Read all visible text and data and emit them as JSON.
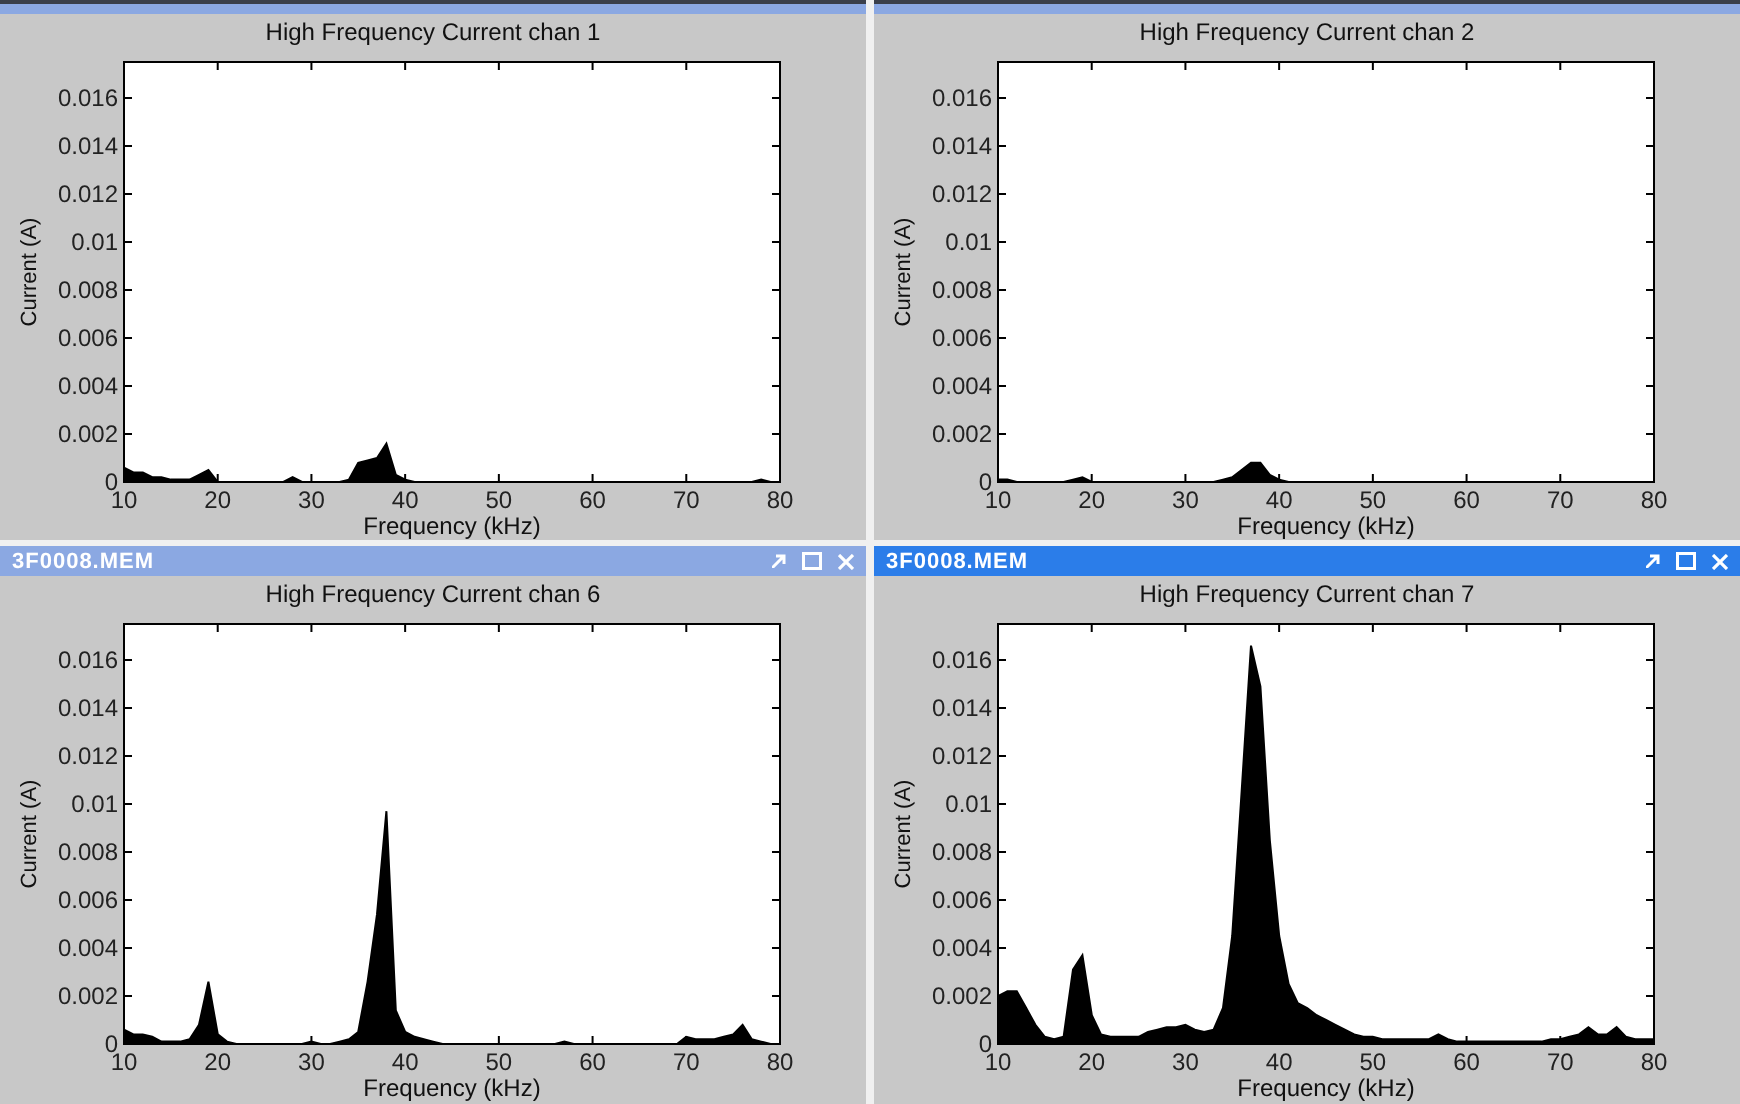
{
  "windows": [
    {
      "active": false,
      "chart_data": {
        "type": "area",
        "title": "High Frequency Current chan 1",
        "xlabel": "Frequency (kHz)",
        "ylabel": "Current (A)",
        "xlim": [
          10,
          80
        ],
        "ylim": [
          0,
          0.0175
        ],
        "xticks": [
          10,
          20,
          30,
          40,
          50,
          60,
          70,
          80
        ],
        "yticks": [
          {
            "value": 0,
            "label": "0"
          },
          {
            "value": 0.002,
            "label": "0.002"
          },
          {
            "value": 0.004,
            "label": "0.004"
          },
          {
            "value": 0.006,
            "label": "0.006"
          },
          {
            "value": 0.008,
            "label": "0.008"
          },
          {
            "value": 0.01,
            "label": "0.01"
          },
          {
            "value": 0.012,
            "label": "0.012"
          },
          {
            "value": 0.014,
            "label": "0.014"
          },
          {
            "value": 0.016,
            "label": "0.016"
          }
        ],
        "x": [
          10,
          11,
          12,
          13,
          14,
          15,
          16,
          17,
          18,
          19,
          20,
          21,
          22,
          23,
          24,
          25,
          26,
          27,
          28,
          29,
          30,
          31,
          32,
          33,
          34,
          35,
          36,
          37,
          38,
          39,
          40,
          41,
          42,
          43,
          44,
          45,
          46,
          47,
          48,
          49,
          50,
          51,
          52,
          53,
          54,
          55,
          56,
          57,
          58,
          59,
          60,
          61,
          62,
          63,
          64,
          65,
          66,
          67,
          68,
          69,
          70,
          71,
          72,
          73,
          74,
          75,
          76,
          77,
          78,
          79,
          80
        ],
        "series": [
          {
            "color": "#000000",
            "values": [
              0.0006,
              0.0004,
              0.0004,
              0.0002,
              0.0002,
              0.0001,
              0.0001,
              0.0001,
              0.0003,
              0.0005,
              0,
              0,
              0,
              0,
              0,
              0,
              0,
              0,
              0.0002,
              0,
              0,
              0,
              0,
              0,
              0.0001,
              0.0008,
              0.0009,
              0.001,
              0.0016,
              0.0003,
              0.0001,
              0,
              0,
              0,
              0,
              0,
              0,
              0,
              0,
              0,
              0,
              0,
              0,
              0,
              0,
              0,
              0,
              0,
              0,
              0,
              0,
              0,
              0,
              0,
              0,
              0,
              0,
              0,
              0,
              0,
              0,
              0,
              0,
              0,
              0,
              0,
              0,
              0,
              0.0001,
              0,
              0
            ]
          }
        ]
      }
    },
    {
      "active": false,
      "chart_data": {
        "type": "area",
        "title": "High Frequency Current chan 2",
        "xlabel": "Frequency (kHz)",
        "ylabel": "Current (A)",
        "xlim": [
          10,
          80
        ],
        "ylim": [
          0,
          0.0175
        ],
        "xticks": [
          10,
          20,
          30,
          40,
          50,
          60,
          70,
          80
        ],
        "yticks": [
          {
            "value": 0,
            "label": "0"
          },
          {
            "value": 0.002,
            "label": "0.002"
          },
          {
            "value": 0.004,
            "label": "0.004"
          },
          {
            "value": 0.006,
            "label": "0.006"
          },
          {
            "value": 0.008,
            "label": "0.008"
          },
          {
            "value": 0.01,
            "label": "0.01"
          },
          {
            "value": 0.012,
            "label": "0.012"
          },
          {
            "value": 0.014,
            "label": "0.014"
          },
          {
            "value": 0.016,
            "label": "0.016"
          }
        ],
        "x": [
          10,
          11,
          12,
          13,
          14,
          15,
          16,
          17,
          18,
          19,
          20,
          21,
          22,
          23,
          24,
          25,
          26,
          27,
          28,
          29,
          30,
          31,
          32,
          33,
          34,
          35,
          36,
          37,
          38,
          39,
          40,
          41,
          42,
          43,
          44,
          45,
          46,
          47,
          48,
          49,
          50,
          51,
          52,
          53,
          54,
          55,
          56,
          57,
          58,
          59,
          60,
          61,
          62,
          63,
          64,
          65,
          66,
          67,
          68,
          69,
          70,
          71,
          72,
          73,
          74,
          75,
          76,
          77,
          78,
          79,
          80
        ],
        "series": [
          {
            "color": "#000000",
            "values": [
              0.0001,
              0.0001,
              0,
              0,
              0,
              0,
              0,
              0,
              0.0001,
              0.0002,
              0,
              0,
              0,
              0,
              0,
              0,
              0,
              0,
              0,
              0,
              0,
              0,
              0,
              0,
              0.0001,
              0.0002,
              0.0005,
              0.0008,
              0.0008,
              0.0003,
              0.0001,
              0,
              0,
              0,
              0,
              0,
              0,
              0,
              0,
              0,
              0,
              0,
              0,
              0,
              0,
              0,
              0,
              0,
              0,
              0,
              0,
              0,
              0,
              0,
              0,
              0,
              0,
              0,
              0,
              0,
              0,
              0,
              0,
              0,
              0,
              0,
              0,
              0,
              0,
              0,
              0
            ]
          }
        ]
      }
    },
    {
      "title": "3F0008.MEM",
      "active": false,
      "chart_data": {
        "type": "area",
        "title": "High Frequency Current chan 6",
        "xlabel": "Frequency (kHz)",
        "ylabel": "Current (A)",
        "xlim": [
          10,
          80
        ],
        "ylim": [
          0,
          0.0175
        ],
        "xticks": [
          10,
          20,
          30,
          40,
          50,
          60,
          70,
          80
        ],
        "yticks": [
          {
            "value": 0,
            "label": "0"
          },
          {
            "value": 0.002,
            "label": "0.002"
          },
          {
            "value": 0.004,
            "label": "0.004"
          },
          {
            "value": 0.006,
            "label": "0.006"
          },
          {
            "value": 0.008,
            "label": "0.008"
          },
          {
            "value": 0.01,
            "label": "0.01"
          },
          {
            "value": 0.012,
            "label": "0.012"
          },
          {
            "value": 0.014,
            "label": "0.014"
          },
          {
            "value": 0.016,
            "label": "0.016"
          }
        ],
        "x": [
          10,
          11,
          12,
          13,
          14,
          15,
          16,
          17,
          18,
          19,
          20,
          21,
          22,
          23,
          24,
          25,
          26,
          27,
          28,
          29,
          30,
          31,
          32,
          33,
          34,
          35,
          36,
          37,
          38,
          39,
          40,
          41,
          42,
          43,
          44,
          45,
          46,
          47,
          48,
          49,
          50,
          51,
          52,
          53,
          54,
          55,
          56,
          57,
          58,
          59,
          60,
          61,
          62,
          63,
          64,
          65,
          66,
          67,
          68,
          69,
          70,
          71,
          72,
          73,
          74,
          75,
          76,
          77,
          78,
          79,
          80
        ],
        "series": [
          {
            "color": "#000000",
            "values": [
              0.0006,
              0.0004,
              0.0004,
              0.0003,
              0.0001,
              0.0001,
              0.0001,
              0.0002,
              0.0008,
              0.0026,
              0.0004,
              0.0001,
              0,
              0,
              0,
              0,
              0,
              0,
              0,
              0,
              0.0001,
              0,
              0,
              0.0001,
              0.0002,
              0.0005,
              0.0026,
              0.0054,
              0.0097,
              0.0014,
              0.0005,
              0.0003,
              0.0002,
              0.0001,
              0,
              0,
              0,
              0,
              0,
              0,
              0,
              0,
              0,
              0,
              0,
              0,
              0,
              0.0001,
              0,
              0,
              0,
              0,
              0,
              0,
              0,
              0,
              0,
              0,
              0,
              0,
              0.0003,
              0.0002,
              0.0002,
              0.0002,
              0.0003,
              0.0004,
              0.0008,
              0.0002,
              0.0001,
              0,
              0
            ]
          }
        ]
      }
    },
    {
      "title": "3F0008.MEM",
      "active": true,
      "chart_data": {
        "type": "area",
        "title": "High Frequency Current chan 7",
        "xlabel": "Frequency (kHz)",
        "ylabel": "Current (A)",
        "xlim": [
          10,
          80
        ],
        "ylim": [
          0,
          0.0175
        ],
        "xticks": [
          10,
          20,
          30,
          40,
          50,
          60,
          70,
          80
        ],
        "yticks": [
          {
            "value": 0,
            "label": "0"
          },
          {
            "value": 0.002,
            "label": "0.002"
          },
          {
            "value": 0.004,
            "label": "0.004"
          },
          {
            "value": 0.006,
            "label": "0.006"
          },
          {
            "value": 0.008,
            "label": "0.008"
          },
          {
            "value": 0.01,
            "label": "0.01"
          },
          {
            "value": 0.012,
            "label": "0.012"
          },
          {
            "value": 0.014,
            "label": "0.014"
          },
          {
            "value": 0.016,
            "label": "0.016"
          }
        ],
        "x": [
          10,
          11,
          12,
          13,
          14,
          15,
          16,
          17,
          18,
          19,
          20,
          21,
          22,
          23,
          24,
          25,
          26,
          27,
          28,
          29,
          30,
          31,
          32,
          33,
          34,
          35,
          36,
          37,
          38,
          39,
          40,
          41,
          42,
          43,
          44,
          45,
          46,
          47,
          48,
          49,
          50,
          51,
          52,
          53,
          54,
          55,
          56,
          57,
          58,
          59,
          60,
          61,
          62,
          63,
          64,
          65,
          66,
          67,
          68,
          69,
          70,
          71,
          72,
          73,
          74,
          75,
          76,
          77,
          78,
          79,
          80
        ],
        "series": [
          {
            "color": "#000000",
            "values": [
              0.002,
              0.0022,
              0.0022,
              0.0015,
              0.0008,
              0.0003,
              0.0002,
              0.0003,
              0.0031,
              0.0037,
              0.0012,
              0.0004,
              0.0003,
              0.0003,
              0.0003,
              0.0003,
              0.0005,
              0.0006,
              0.0007,
              0.0007,
              0.0008,
              0.0006,
              0.0005,
              0.0006,
              0.0015,
              0.0045,
              0.0105,
              0.0166,
              0.0149,
              0.0085,
              0.0045,
              0.0025,
              0.0017,
              0.0015,
              0.0012,
              0.001,
              0.0008,
              0.0006,
              0.0004,
              0.0003,
              0.0003,
              0.0002,
              0.0002,
              0.0002,
              0.0002,
              0.0002,
              0.0002,
              0.0004,
              0.0002,
              0.0001,
              0.0001,
              0.0001,
              0.0001,
              0.0001,
              0.0001,
              0.0001,
              0.0001,
              0.0001,
              0.0001,
              0.0002,
              0.0002,
              0.0003,
              0.0004,
              0.0007,
              0.0004,
              0.0004,
              0.0007,
              0.0003,
              0.0002,
              0.0002,
              0.0002
            ]
          }
        ]
      }
    }
  ]
}
